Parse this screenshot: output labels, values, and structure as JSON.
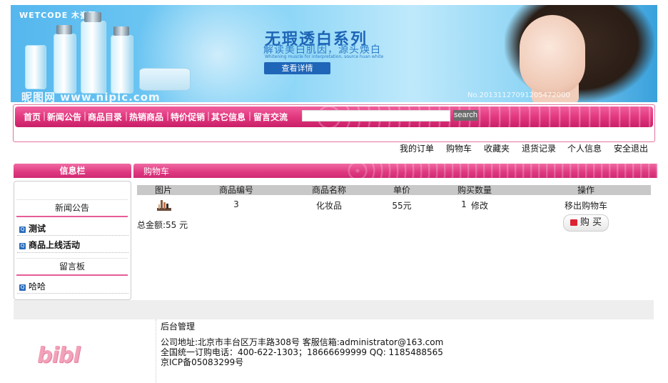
{
  "banner": {
    "brand": "WETCODE 木瓷码",
    "headline": "无瑕透白系列",
    "subline": "解读美白肌因，源头焕白",
    "subline_en": "Whitening muscle for interpretation, source huan white",
    "cta": "查看详情",
    "watermark": "昵图网 www.nipic.com",
    "watermark_id": "No.20131127091205472000"
  },
  "nav": {
    "items": [
      "首页",
      "新闻公告",
      "商品目录",
      "热销商品",
      "特价促销",
      "其它信息",
      "留言交流"
    ],
    "search_button": "search",
    "search_value": ""
  },
  "user_links": [
    "我的订单",
    "购物车",
    "收藏夹",
    "退货记录",
    "个人信息",
    "安全退出"
  ],
  "sidebar": {
    "title": "信息栏",
    "news_title": "新闻公告",
    "news_items": [
      "测试",
      "商品上线活动"
    ],
    "board_title": "留言板",
    "board_items": [
      "哈哈"
    ]
  },
  "cart": {
    "title": "购物车",
    "columns": [
      "图片",
      "商品编号",
      "商品名称",
      "单价",
      "购买数量",
      "操作"
    ],
    "row": {
      "id": "3",
      "name": "化妆品",
      "price": "55元",
      "qty": "1",
      "edit": "修改",
      "remove": "移出购物车"
    },
    "total": "总金额:55 元",
    "buy": "购 买"
  },
  "footer": {
    "admin": "后台管理",
    "address": "公司地址:北京市丰台区万丰路308号   客服信箱:administrator@163.com",
    "phone": "全国统一订购电话：400-622-1303；18666699999   QQ: 1185488565",
    "icp": "京ICP备05083299号",
    "logo": "bibl"
  }
}
